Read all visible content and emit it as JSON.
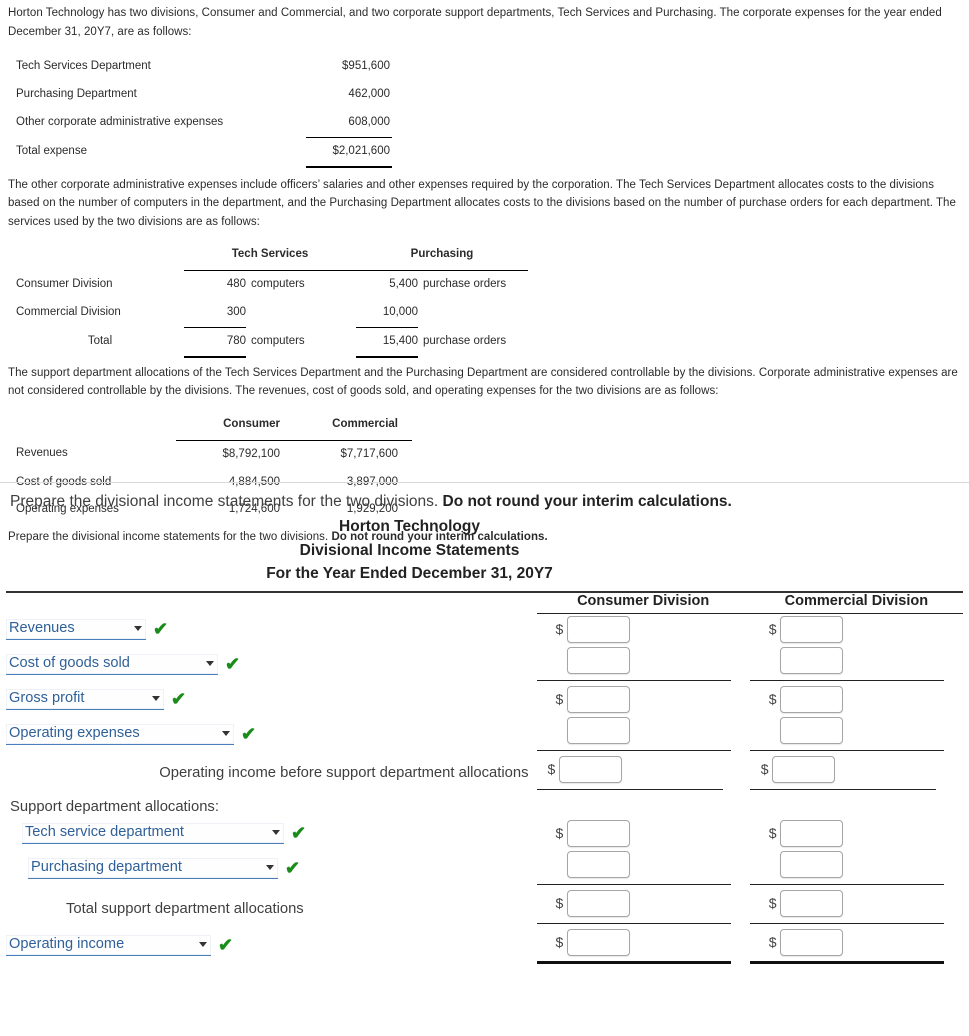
{
  "problem": {
    "paragraph_1": "Horton Technology has two divisions, Consumer and Commercial, and two corporate support departments, Tech Services and Purchasing. The corporate expenses for the year ended December 31, 20Y7, are as follows:",
    "paragraph_2": "The other corporate administrative expenses include officers’ salaries and other expenses required by the corporation. The Tech Services Department allocates costs to the divisions based on the number of computers in the department, and the Purchasing Department allocates costs to the divisions based on the number of purchase orders for each department. The services used by the two divisions are as follows:",
    "paragraph_3": "The support department allocations of the Tech Services Department and the Purchasing Department are considered controllable by the divisions. Corporate administrative expenses are not considered controllable by the divisions. The revenues, cost of goods sold, and operating expenses for the two divisions are as follows:",
    "instruction_normal": "Prepare the divisional income statements for the two divisions. ",
    "instruction_bold": "Do not round your interim calculations."
  },
  "expense_table": {
    "rows": [
      {
        "label": "Tech Services Department",
        "amount": "$951,600"
      },
      {
        "label": "Purchasing Department",
        "amount": "462,000"
      },
      {
        "label": "Other corporate administrative expenses",
        "amount": "608,000"
      }
    ],
    "total": {
      "label": "Total expense",
      "amount": "$2,021,600"
    }
  },
  "services_table": {
    "headers": {
      "col1": "Tech Services",
      "col2": "Purchasing"
    },
    "rows": [
      {
        "label": "Consumer Division",
        "tech_num": "480",
        "tech_unit": "computers",
        "purch_num": "5,400",
        "purch_unit": "purchase orders"
      },
      {
        "label": "Commercial Division",
        "tech_num": "300",
        "tech_unit": "",
        "purch_num": "10,000",
        "purch_unit": ""
      }
    ],
    "total": {
      "label": "Total",
      "tech_num": "780",
      "tech_unit": "computers",
      "purch_num": "15,400",
      "purch_unit": "purchase orders"
    }
  },
  "divisions_table": {
    "headers": {
      "col1": "Consumer",
      "col2": "Commercial"
    },
    "rows": [
      {
        "label": "Revenues",
        "consumer": "$8,792,100",
        "commercial": "$7,717,600"
      },
      {
        "label": "Cost of goods sold",
        "consumer": "4,884,500",
        "commercial": "3,897,000"
      },
      {
        "label": "Operating expenses",
        "consumer": "1,724,600",
        "commercial": "1,929,200"
      }
    ]
  },
  "form": {
    "prompt_normal": "Prepare the divisional income statements for the two divisions. ",
    "prompt_bold": "Do not round your interim calculations.",
    "title_line_1": "Horton Technology",
    "title_line_2": "Divisional Income Statements",
    "title_line_3": "For the Year Ended December 31, 20Y7",
    "column_headers": {
      "consumer": "Consumer Division",
      "commercial": "Commercial Division"
    },
    "dollar_sign": "$",
    "check_mark": "✔",
    "rows": {
      "revenues": "Revenues",
      "cost_of_goods_sold": "Cost of goods sold",
      "gross_profit": "Gross profit",
      "operating_expenses": "Operating expenses",
      "operating_income_before": "Operating income before support department allocations",
      "support_allocations_header": "Support department allocations:",
      "tech_service_department": "Tech service department",
      "purchasing_department": "Purchasing department",
      "total_support_allocations": "Total support department allocations",
      "operating_income": "Operating income"
    },
    "input_values": {
      "revenues_consumer": "",
      "revenues_commercial": "",
      "cogs_consumer": "",
      "cogs_commercial": "",
      "gross_profit_consumer": "",
      "gross_profit_commercial": "",
      "opex_consumer": "",
      "opex_commercial": "",
      "oi_before_consumer": "",
      "oi_before_commercial": "",
      "tech_consumer": "",
      "tech_commercial": "",
      "purch_consumer": "",
      "purch_commercial": "",
      "total_support_consumer": "",
      "total_support_commercial": "",
      "operating_income_consumer": "",
      "operating_income_commercial": ""
    }
  },
  "colors": {
    "dropdown_text": "#2f6099",
    "dropdown_border": "#4a7ebb",
    "check_green": "#1a8c1a",
    "rule_dark": "#222222"
  }
}
